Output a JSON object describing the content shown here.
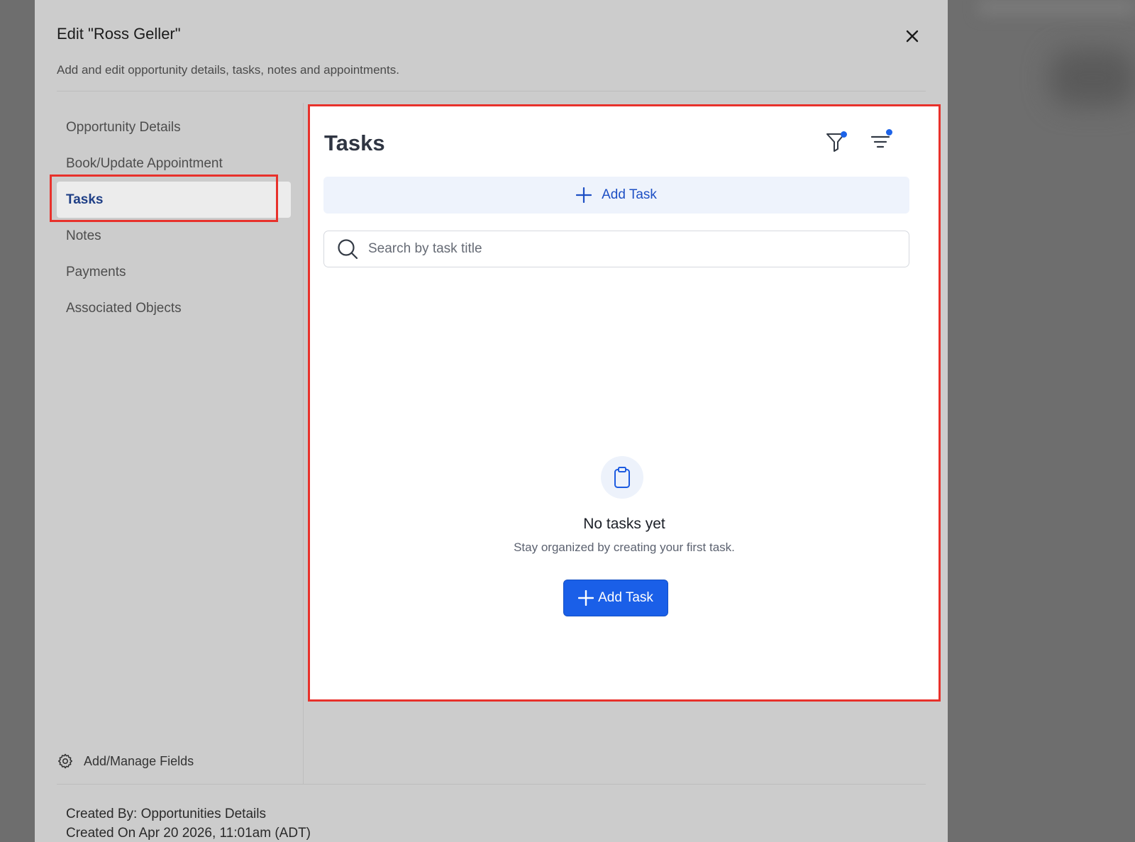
{
  "modal": {
    "title": "Edit \"Ross Geller\"",
    "subtitle": "Add and edit opportunity details, tasks, notes and appointments."
  },
  "sidebar": {
    "items": [
      {
        "label": "Opportunity Details",
        "active": false
      },
      {
        "label": "Book/Update Appointment",
        "active": false
      },
      {
        "label": "Tasks",
        "active": true
      },
      {
        "label": "Notes",
        "active": false
      },
      {
        "label": "Payments",
        "active": false
      },
      {
        "label": "Associated Objects",
        "active": false
      }
    ],
    "manage_fields_label": "Add/Manage Fields"
  },
  "footer": {
    "created_by": "Created By: Opportunities Details",
    "created_on": "Created On Apr 20 2026, 11:01am (ADT)"
  },
  "tasks_panel": {
    "title": "Tasks",
    "add_task_label": "Add Task",
    "search_placeholder": "Search by task title",
    "empty_title": "No tasks yet",
    "empty_description": "Stay organized by creating your first task.",
    "empty_add_task_label": "Add Task"
  },
  "icons": {
    "close": "close-icon",
    "filter": "filter-icon",
    "sort": "sort-icon",
    "search": "search-icon",
    "plus": "plus-icon",
    "clipboard": "clipboard-icon",
    "gear": "gear-icon"
  },
  "colors": {
    "accent": "#1a5fe8",
    "active_nav_text": "#1f3f86",
    "highlight_border": "#e8312b",
    "indicator_dot": "#1d63e8"
  }
}
